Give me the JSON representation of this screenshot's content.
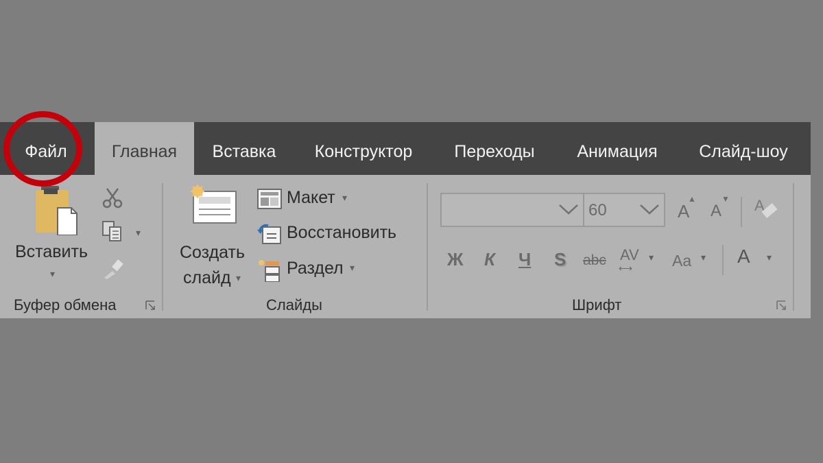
{
  "tabs": [
    {
      "label": "Файл"
    },
    {
      "label": "Главная"
    },
    {
      "label": "Вставка"
    },
    {
      "label": "Конструктор"
    },
    {
      "label": "Переходы"
    },
    {
      "label": "Анимация"
    },
    {
      "label": "Слайд-шоу"
    }
  ],
  "clipboard": {
    "paste_label": "Вставить",
    "group_label": "Буфер обмена"
  },
  "slides": {
    "new_slide_line1": "Создать",
    "new_slide_line2": "слайд",
    "layout_label": "Макет",
    "reset_label": "Восстановить",
    "section_label": "Раздел",
    "group_label": "Слайды"
  },
  "font": {
    "font_name": "",
    "font_size": "60",
    "bold": "Ж",
    "italic": "К",
    "underline": "Ч",
    "shadow": "S",
    "strike": "abc",
    "spacing": "AV",
    "change_case": "Aa",
    "font_color": "A",
    "grow": "A",
    "shrink": "A",
    "group_label": "Шрифт"
  },
  "colors": {
    "tabbar": "#444444",
    "ribbon": "#b3b3b3",
    "highlight": "#c4000b"
  }
}
